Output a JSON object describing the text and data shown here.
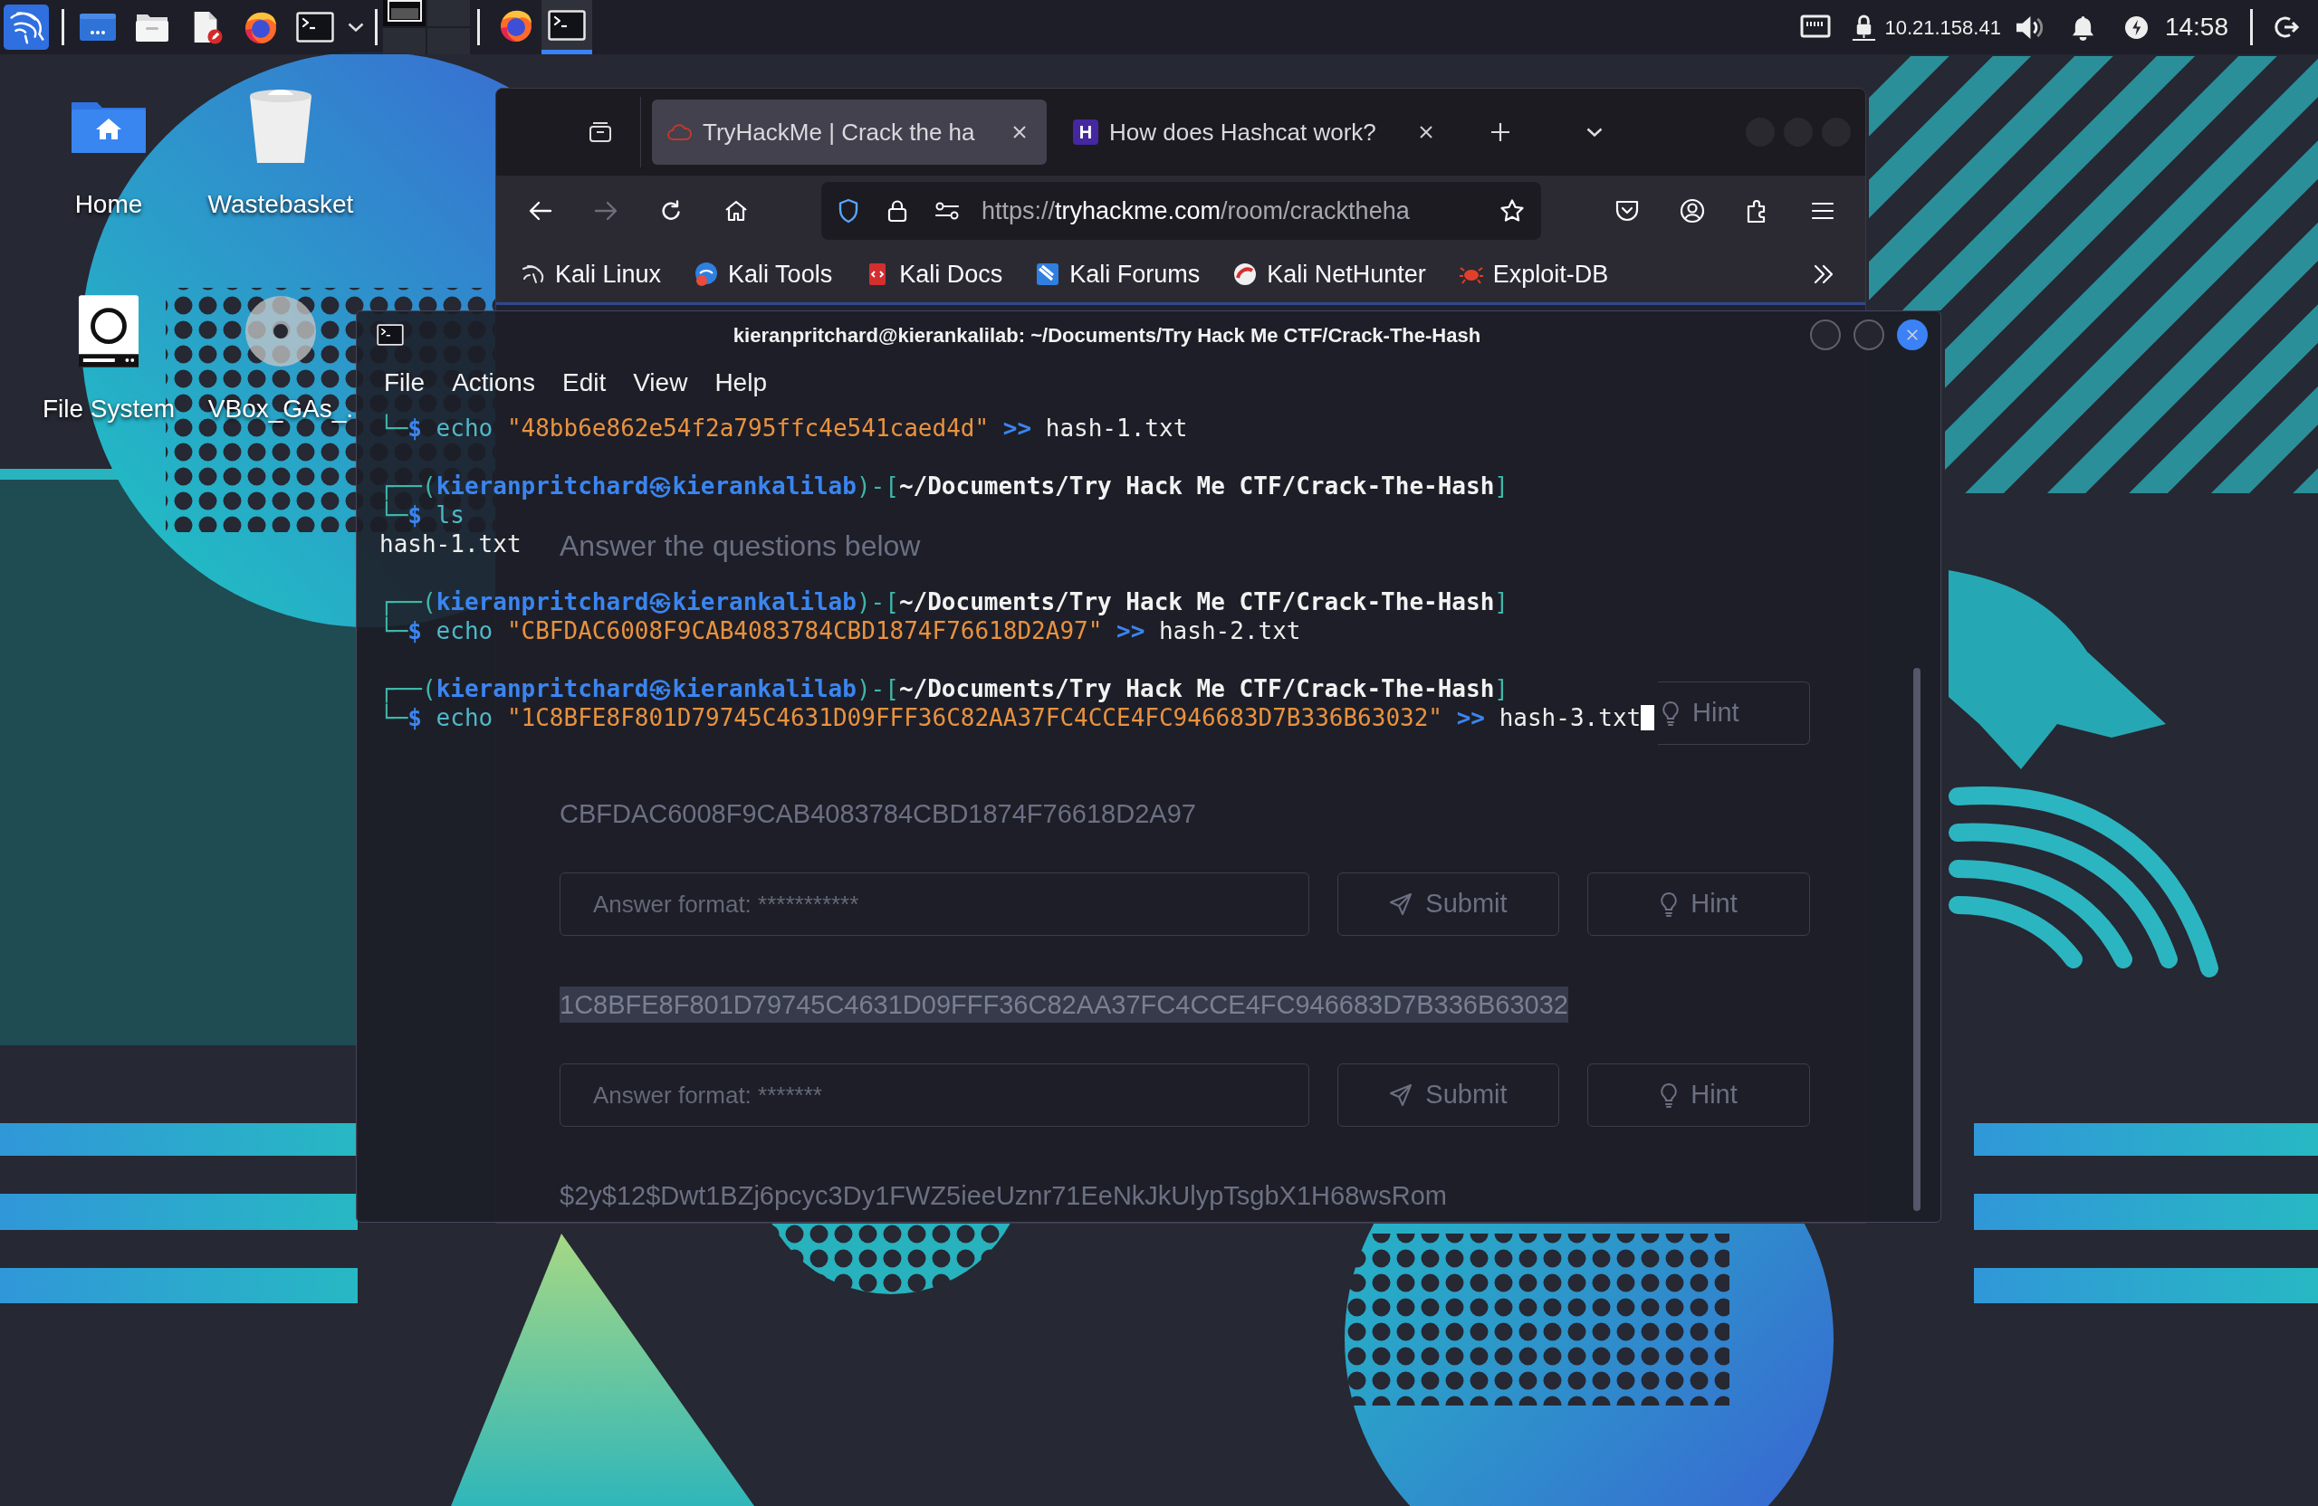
{
  "panel": {
    "launchers": [
      {
        "kind": "desktop"
      },
      {
        "kind": "files"
      },
      {
        "kind": "editor"
      },
      {
        "kind": "browser"
      },
      {
        "kind": "terminal"
      }
    ],
    "workspaces": [
      {
        "selected": true
      },
      {
        "selected": false
      },
      {
        "selected": false
      },
      {
        "selected": false
      }
    ],
    "tasks": [
      {
        "kind": "browser",
        "selected": false
      },
      {
        "kind": "terminal",
        "selected": true
      }
    ],
    "ip": "10.21.158.41",
    "clock": "14:58"
  },
  "desktop_icons": [
    {
      "kind": "home",
      "label": "Home"
    },
    {
      "kind": "trash",
      "label": "Wastebasket"
    },
    {
      "kind": "drive",
      "label": "File System"
    },
    {
      "kind": "disc",
      "label": "VBox_GAs_."
    }
  ],
  "browser": {
    "tabs": [
      {
        "kind": "cloud",
        "title": "TryHackMe | Crack the ha",
        "selected": true
      },
      {
        "kind": "letter",
        "favicon": "H",
        "title": "How does Hashcat work?",
        "selected": false
      }
    ],
    "nav": [
      {
        "kind": "back",
        "disabled": false
      },
      {
        "kind": "forward",
        "disabled": true
      },
      {
        "kind": "reload",
        "disabled": false
      },
      {
        "kind": "home",
        "disabled": false
      }
    ],
    "url": {
      "scheme": "https://",
      "host": "tryhackme.com",
      "path": "/room/cracktheha"
    },
    "bookmarks": [
      {
        "kind": "kali",
        "label": "Kali Linux"
      },
      {
        "kind": "tools",
        "label": "Kali Tools"
      },
      {
        "kind": "docs",
        "label": "Kali Docs"
      },
      {
        "kind": "forums",
        "label": "Kali Forums"
      },
      {
        "kind": "nethunter",
        "label": "Kali NetHunter"
      },
      {
        "kind": "exploit",
        "label": "Exploit-DB"
      }
    ],
    "page": {
      "heading": "Answer the questions below",
      "blocks": [
        {
          "kind": "answer",
          "buttons": [
            {
              "kind": "hint",
              "label": "Hint"
            }
          ]
        },
        {
          "kind": "hash",
          "text": "CBFDAC6008F9CAB4083784CBD1874F76618D2A97",
          "selected": false
        },
        {
          "kind": "answer",
          "placeholder": "Answer format: ***********",
          "buttons": [
            {
              "kind": "submit",
              "label": "Submit"
            },
            {
              "kind": "hint",
              "label": "Hint"
            }
          ]
        },
        {
          "kind": "hash",
          "text": "1C8BFE8F801D79745C4631D09FFF36C82AA37FC4CCE4FC946683D7B336B63032",
          "selected": true
        },
        {
          "kind": "answer",
          "placeholder": "Answer format: *******",
          "buttons": [
            {
              "kind": "submit",
              "label": "Submit"
            },
            {
              "kind": "hint",
              "label": "Hint"
            }
          ]
        },
        {
          "kind": "hash",
          "text": "$2y$12$Dwt1BZj6pcyc3Dy1FWZ5ieeUznr71EeNkJkUlypTsgbX1H68wsRom",
          "selected": false
        }
      ]
    }
  },
  "terminal": {
    "title": "kieranpritchard@kierankalilab: ~/Documents/Try Hack Me CTF/Crack-The-Hash",
    "menu": [
      "File",
      "Actions",
      "Edit",
      "View",
      "Help"
    ],
    "blocks": [
      [
        [
          {
            "kind": "frame",
            "text": "└─"
          },
          {
            "kind": "sigil",
            "text": "$"
          },
          {
            "kind": "command",
            "text": " echo"
          },
          {
            "kind": "string",
            "text": " \"48bb6e862e54f2a795ffc4e541caed4d\""
          },
          {
            "kind": "operator",
            "text": " >>"
          },
          {
            "kind": "plain",
            "text": " hash-1.txt"
          }
        ]
      ],
      [
        [
          {
            "kind": "frame",
            "text": "┌──("
          },
          {
            "kind": "user",
            "text": "kieranpritchard㉿kierankalilab"
          },
          {
            "kind": "frame",
            "text": ")-["
          },
          {
            "kind": "path",
            "text": "~/Documents/Try Hack Me CTF/Crack-The-Hash"
          },
          {
            "kind": "frame",
            "text": "]"
          }
        ],
        [
          {
            "kind": "frame",
            "text": "└─"
          },
          {
            "kind": "sigil",
            "text": "$"
          },
          {
            "kind": "command",
            "text": " ls"
          }
        ],
        [
          {
            "kind": "plain",
            "text": "hash-1.txt"
          }
        ]
      ],
      [
        [
          {
            "kind": "frame",
            "text": "┌──("
          },
          {
            "kind": "user",
            "text": "kieranpritchard㉿kierankalilab"
          },
          {
            "kind": "frame",
            "text": ")-["
          },
          {
            "kind": "path",
            "text": "~/Documents/Try Hack Me CTF/Crack-The-Hash"
          },
          {
            "kind": "frame",
            "text": "]"
          }
        ],
        [
          {
            "kind": "frame",
            "text": "└─"
          },
          {
            "kind": "sigil",
            "text": "$"
          },
          {
            "kind": "command",
            "text": " echo"
          },
          {
            "kind": "string",
            "text": " \"CBFDAC6008F9CAB4083784CBD1874F76618D2A97\""
          },
          {
            "kind": "operator",
            "text": " >>"
          },
          {
            "kind": "plain",
            "text": " hash-2.txt"
          }
        ]
      ],
      [
        [
          {
            "kind": "frame",
            "text": "┌──("
          },
          {
            "kind": "user",
            "text": "kieranpritchard㉿kierankalilab"
          },
          {
            "kind": "frame",
            "text": ")-["
          },
          {
            "kind": "path",
            "text": "~/Documents/Try Hack Me CTF/Crack-The-Hash"
          },
          {
            "kind": "frame",
            "text": "]"
          }
        ],
        [
          {
            "kind": "frame",
            "text": "└─"
          },
          {
            "kind": "sigil",
            "text": "$"
          },
          {
            "kind": "command",
            "text": " echo"
          },
          {
            "kind": "string",
            "text": " \"1C8BFE8F801D79745C4631D09FFF36C82AA37FC4CCE4FC946683D7B336B63032\""
          },
          {
            "kind": "operator",
            "text": " >>"
          },
          {
            "kind": "plain",
            "text": " hash-3.txt"
          }
        ]
      ]
    ],
    "cursor": true
  }
}
